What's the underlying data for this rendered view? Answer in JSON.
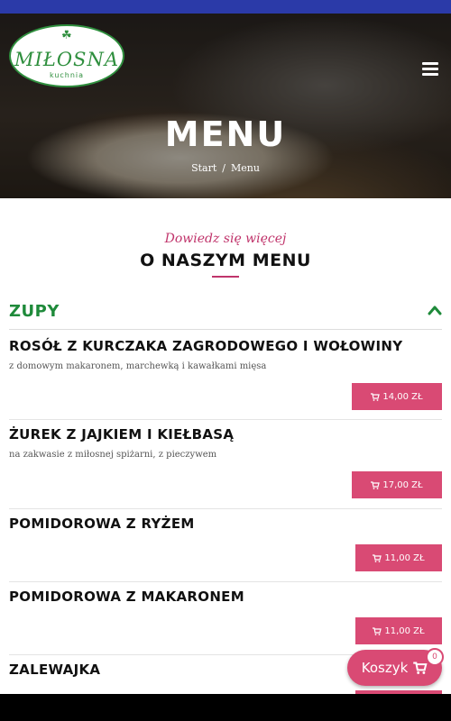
{
  "brand": {
    "name": "MIŁOSNA",
    "sub": "kuchnia"
  },
  "hero": {
    "title": "MENU",
    "breadcrumb": [
      "Start",
      "Menu"
    ],
    "separator": "/"
  },
  "intro": {
    "script": "Dowiedz się więcej",
    "title": "O NASZYM MENU"
  },
  "category": {
    "title": "ZUPY",
    "expanded": true
  },
  "items": [
    {
      "name": "ROSÓŁ Z KURCZAKA ZAGRODOWEGO I WOŁOWINY",
      "desc": "z domowym makaronem, marchewką i kawałkami mięsa",
      "price": "14,00 ZŁ"
    },
    {
      "name": "ŻUREK Z JAJKIEM I KIEŁBASĄ",
      "desc": "na zakwasie z miłosnej spiżarni, z pieczywem",
      "price": "17,00 ZŁ"
    },
    {
      "name": "POMIDOROWA Z RYŻEM",
      "desc": "",
      "price": "11,00 ZŁ"
    },
    {
      "name": "POMIDOROWA Z MAKARONEM",
      "desc": "",
      "price": "11,00 ZŁ"
    },
    {
      "name": "ZALEWAJKA",
      "desc": "",
      "price": ""
    }
  ],
  "cart": {
    "label": "Koszyk",
    "count": "0"
  },
  "colors": {
    "topbar": "#2b3aa8",
    "accent": "#d94a74",
    "green": "#1e8a3a"
  }
}
